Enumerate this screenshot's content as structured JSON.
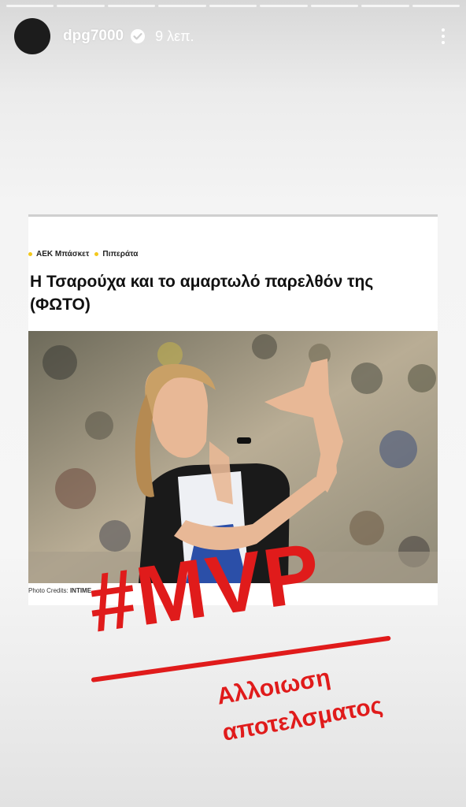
{
  "story": {
    "progress_segments": 9,
    "username": "dpg7000",
    "time_ago": "9 λεπ.",
    "verified_icon": "verified-check-icon",
    "menu_icon": "more-vertical-icon"
  },
  "article": {
    "breadcrumbs": [
      "AEK Μπάσκετ",
      "Πιπεράτα"
    ],
    "headline": "Η Τσαρούχα και το αμαρτωλό παρελθόν της (ΦΩΤΟ)",
    "photo_alt": "photo",
    "credits_label": "Photo Credits:",
    "credits_value": "INTIME"
  },
  "overlay": {
    "hashtag": "#MVP",
    "caption_line1": "Αλλοιωση",
    "caption_line2": "αποτελσματος",
    "color": "#e01b1b"
  },
  "colors": {
    "accent_dot": "#f3c81c"
  }
}
